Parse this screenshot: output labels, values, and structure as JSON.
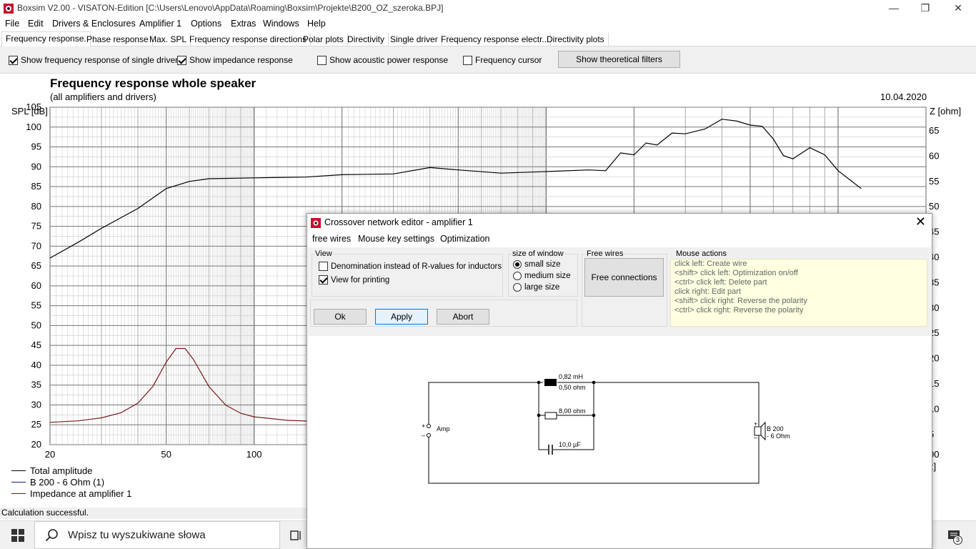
{
  "window": {
    "title": "Boxsim V2.00 - VISATON-Edition [C:\\Users\\Lenovo\\AppData\\Roaming\\Boxsim\\Projekte\\B200_OZ_szeroka.BPJ]",
    "minimize": "—",
    "restore": "❐",
    "close": "✕"
  },
  "menu": [
    "File",
    "Edit",
    "Drivers & Enclosures",
    "Amplifier 1",
    "Options",
    "Extras",
    "Windows",
    "Help"
  ],
  "tabs": [
    "Frequency response.",
    "Phase response",
    "Max. SPL",
    "Frequency response directions",
    "Polar plots",
    "Directivity",
    "Single driver",
    "Frequency response electr..",
    "Directivity plots"
  ],
  "options": {
    "single_driver": {
      "label": "Show frequency response of single driver",
      "checked": true
    },
    "impedance": {
      "label": "Show impedance response",
      "checked": true
    },
    "acoustic_power": {
      "label": "Show acoustic power response",
      "checked": false
    },
    "cursor": {
      "label": "Frequency cursor",
      "checked": false
    },
    "theoretical_filters": "Show theoretical filters"
  },
  "chart_header": {
    "title": "Frequency response whole speaker",
    "subtitle": "(all amplifiers and drivers)",
    "date": "10.04.2020",
    "ylabel_left": "SPL [dB]",
    "ylabel_right": "Z [ohm]",
    "xlabel_partial": "z]"
  },
  "chart_data": {
    "type": "line",
    "x_scale": "log",
    "xlim": [
      20,
      20000
    ],
    "ylim_left": [
      20,
      105
    ],
    "ylim_right": [
      0,
      65
    ],
    "x_ticks_visible": [
      20,
      50,
      100
    ],
    "x_tick_partial_right": "00",
    "y_ticks_left": [
      20,
      25,
      30,
      35,
      40,
      45,
      50,
      55,
      60,
      65,
      70,
      75,
      80,
      85,
      90,
      95,
      100,
      105
    ],
    "y_ticks_right": [
      5,
      10,
      15,
      20,
      25,
      30,
      35,
      40,
      45,
      50,
      55,
      60,
      65
    ],
    "grid": true,
    "series": [
      {
        "name": "Total amplitude",
        "color": "#000000",
        "axis": "left",
        "points": [
          [
            20,
            67
          ],
          [
            25,
            71
          ],
          [
            30,
            74.5
          ],
          [
            40,
            79.5
          ],
          [
            50,
            84.5
          ],
          [
            60,
            86.3
          ],
          [
            70,
            87
          ],
          [
            100,
            87.2
          ],
          [
            150,
            87.4
          ],
          [
            200,
            88
          ],
          [
            300,
            88.2
          ],
          [
            400,
            89.8
          ],
          [
            500,
            89.2
          ],
          [
            700,
            88.4
          ],
          [
            1000,
            88.8
          ],
          [
            1400,
            89.2
          ],
          [
            1600,
            89.0
          ],
          [
            1800,
            93.5
          ],
          [
            2000,
            93.0
          ],
          [
            2200,
            96
          ],
          [
            2400,
            95.5
          ],
          [
            2700,
            98.5
          ],
          [
            3000,
            98.3
          ],
          [
            3500,
            99.5
          ],
          [
            4000,
            102.0
          ],
          [
            4500,
            101.5
          ],
          [
            5000,
            100.5
          ],
          [
            5500,
            100.2
          ],
          [
            6000,
            97
          ],
          [
            6500,
            92.8
          ],
          [
            7000,
            92.0
          ],
          [
            8000,
            94.8
          ],
          [
            9000,
            93
          ],
          [
            10000,
            89
          ],
          [
            12000,
            84.5
          ]
        ]
      },
      {
        "name": "B 200 - 6 Ohm (1)",
        "color": "#1a1a7a",
        "axis": "left",
        "points": []
      },
      {
        "name": "Impedance at amplifier 1",
        "color": "#7a1a1a",
        "axis": "right",
        "points": [
          [
            20,
            7.4
          ],
          [
            25,
            7.7
          ],
          [
            30,
            8.3
          ],
          [
            35,
            9.3
          ],
          [
            40,
            11.2
          ],
          [
            45,
            14.5
          ],
          [
            50,
            19.3
          ],
          [
            54,
            22
          ],
          [
            58,
            22
          ],
          [
            62,
            19.8
          ],
          [
            70,
            14.5
          ],
          [
            80,
            10.8
          ],
          [
            90,
            9.2
          ],
          [
            100,
            8.5
          ],
          [
            130,
            7.8
          ],
          [
            180,
            7.5
          ]
        ]
      }
    ]
  },
  "legend": [
    "Total amplitude",
    "B 200 - 6 Ohm (1)",
    "Impedance at amplifier 1"
  ],
  "status": "Calculation successful.",
  "taskbar": {
    "search_placeholder": "Wpisz tu wyszukiwane słowa",
    "badge": "3"
  },
  "dialog": {
    "title": "Crossover network editor - amplifier 1",
    "close": "✕",
    "menu": [
      "free wires",
      "Mouse key settings",
      "Optimization"
    ],
    "view": {
      "label": "View",
      "denomination": {
        "label": "Denomination instead of R-values for inductors",
        "checked": false
      },
      "printing": {
        "label": "View for printing",
        "checked": true
      }
    },
    "size": {
      "label": "size of window",
      "options": [
        {
          "label": "small size",
          "selected": true
        },
        {
          "label": "medium size",
          "selected": false
        },
        {
          "label": "large size",
          "selected": false
        }
      ]
    },
    "free_wires": {
      "label": "Free wires",
      "button": "Free connections"
    },
    "buttons": {
      "ok": "Ok",
      "apply": "Apply",
      "abort": "Abort"
    },
    "mouse_actions": {
      "label": "Mouse actions",
      "lines": [
        "click left: Create wire",
        "<shift> click left: Optimization on/off",
        "<ctrl> click left: Delete part",
        "click right: Edit part",
        "<shift> click right: Reverse the polarity",
        "<ctrl> click right: Reverse the polarity"
      ]
    },
    "schematic": {
      "inductor_value": "0,82 mH",
      "inductor_resistance": "0,50 ohm",
      "resistor_value": "8,00 ohm",
      "capacitor_value": "10,0 µF",
      "amp_label": "Amp",
      "driver_label_1": "B 200",
      "driver_label_2": "- 6 Ohm",
      "plus": "+",
      "minus": "–"
    }
  }
}
